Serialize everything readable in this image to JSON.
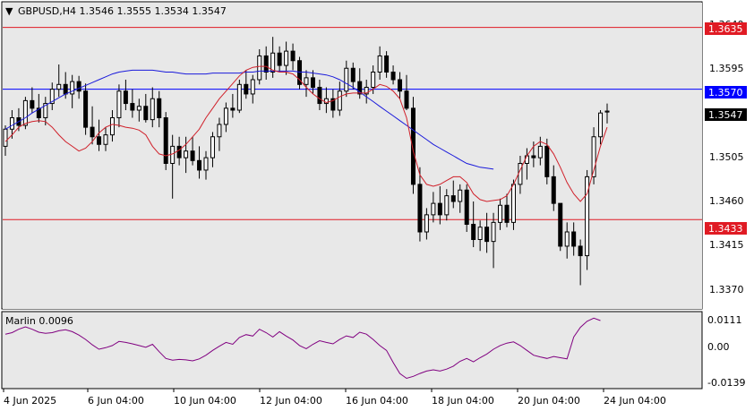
{
  "header": {
    "dropdown_glyph": "▼",
    "symbol_line": "GBPUSD,H4  1.3546 1.3555 1.3534 1.3547"
  },
  "price_axis": {
    "ticks": [
      "1.3640",
      "1.3595",
      "1.3550",
      "1.3505",
      "1.3460",
      "1.3415",
      "1.3370"
    ],
    "tags": [
      {
        "label": "1.3635",
        "value": 1.3635,
        "color": "#e01b24",
        "kind": "horizontal-line"
      },
      {
        "label": "1.3570",
        "value": 1.357,
        "color": "#0000ff",
        "kind": "horizontal-line"
      },
      {
        "label": "1.3547",
        "value": 1.3547,
        "color": "#000000",
        "kind": "current-price"
      },
      {
        "label": "1.3433",
        "value": 1.3433,
        "color": "#e01b24",
        "kind": "horizontal-line"
      }
    ]
  },
  "indicator_panel": {
    "label": "Marlin 0.0096",
    "ticks": [
      "0.0111",
      "0.00",
      "-0.0139"
    ],
    "color": "#800080"
  },
  "time_axis": {
    "labels": [
      "4 Jun 2025",
      "6 Jun 04:00",
      "10 Jun 04:00",
      "12 Jun 04:00",
      "16 Jun 04:00",
      "18 Jun 04:00",
      "20 Jun 04:00",
      "24 Jun 04:00"
    ]
  },
  "colors": {
    "background": "#e8e8e8",
    "bull_fill": "#ffffff",
    "bear_fill": "#000000",
    "slow_ma": "#1a1adb",
    "fast_ma": "#d0202a",
    "oscillator": "#800080"
  },
  "chart_data": {
    "type": "candlestick",
    "symbol": "GBPUSD",
    "timeframe": "H4",
    "last_bar": {
      "open": 1.3546,
      "high": 1.3555,
      "low": 1.3534,
      "close": 1.3547
    },
    "price_range": [
      1.334,
      1.366
    ],
    "ohlc": [
      [
        1.351,
        1.3532,
        1.35,
        1.3528
      ],
      [
        1.3528,
        1.3548,
        1.3518,
        1.354
      ],
      [
        1.354,
        1.355,
        1.3526,
        1.3532
      ],
      [
        1.3532,
        1.3562,
        1.3528,
        1.3558
      ],
      [
        1.3558,
        1.3572,
        1.3545,
        1.355
      ],
      [
        1.355,
        1.3565,
        1.3535,
        1.354
      ],
      [
        1.354,
        1.3562,
        1.3532,
        1.3555
      ],
      [
        1.3555,
        1.3577,
        1.3548,
        1.357
      ],
      [
        1.357,
        1.3596,
        1.3562,
        1.3575
      ],
      [
        1.3575,
        1.3588,
        1.356,
        1.3565
      ],
      [
        1.3565,
        1.3585,
        1.355,
        1.3578
      ],
      [
        1.3578,
        1.3584,
        1.356,
        1.3568
      ],
      [
        1.3568,
        1.3576,
        1.3522,
        1.353
      ],
      [
        1.353,
        1.3552,
        1.3512,
        1.352
      ],
      [
        1.352,
        1.3538,
        1.3505,
        1.3512
      ],
      [
        1.3512,
        1.353,
        1.3505,
        1.3522
      ],
      [
        1.3522,
        1.3548,
        1.3515,
        1.354
      ],
      [
        1.354,
        1.3575,
        1.353,
        1.3568
      ],
      [
        1.3568,
        1.358,
        1.3548,
        1.3555
      ],
      [
        1.3555,
        1.357,
        1.354,
        1.3548
      ],
      [
        1.3548,
        1.356,
        1.3536,
        1.3552
      ],
      [
        1.3552,
        1.3565,
        1.3535,
        1.3538
      ],
      [
        1.3538,
        1.3572,
        1.353,
        1.356
      ],
      [
        1.356,
        1.3568,
        1.353,
        1.354
      ],
      [
        1.354,
        1.3546,
        1.3485,
        1.3492
      ],
      [
        1.3492,
        1.3522,
        1.3455,
        1.351
      ],
      [
        1.351,
        1.352,
        1.349,
        1.3498
      ],
      [
        1.3498,
        1.352,
        1.3482,
        1.3505
      ],
      [
        1.3505,
        1.352,
        1.349,
        1.3495
      ],
      [
        1.3495,
        1.351,
        1.3476,
        1.3485
      ],
      [
        1.3485,
        1.3505,
        1.3475,
        1.3498
      ],
      [
        1.3498,
        1.3525,
        1.3488,
        1.352
      ],
      [
        1.352,
        1.354,
        1.3505,
        1.3533
      ],
      [
        1.3533,
        1.3556,
        1.3525,
        1.355
      ],
      [
        1.355,
        1.3565,
        1.354,
        1.3548
      ],
      [
        1.3548,
        1.358,
        1.3545,
        1.3575
      ],
      [
        1.3575,
        1.359,
        1.356,
        1.3565
      ],
      [
        1.3565,
        1.3585,
        1.3555,
        1.358
      ],
      [
        1.358,
        1.3612,
        1.3575,
        1.3605
      ],
      [
        1.3605,
        1.3615,
        1.358,
        1.3588
      ],
      [
        1.3588,
        1.3625,
        1.3582,
        1.3608
      ],
      [
        1.3608,
        1.3615,
        1.3588,
        1.3595
      ],
      [
        1.3595,
        1.362,
        1.3585,
        1.361
      ],
      [
        1.361,
        1.3618,
        1.359,
        1.36
      ],
      [
        1.36,
        1.3604,
        1.357,
        1.3575
      ],
      [
        1.3575,
        1.359,
        1.3562,
        1.3582
      ],
      [
        1.3582,
        1.359,
        1.3565,
        1.3572
      ],
      [
        1.3572,
        1.358,
        1.3548,
        1.3555
      ],
      [
        1.3555,
        1.3572,
        1.3545,
        1.356
      ],
      [
        1.356,
        1.357,
        1.354,
        1.3548
      ],
      [
        1.3548,
        1.3578,
        1.3542,
        1.3568
      ],
      [
        1.3568,
        1.36,
        1.3562,
        1.3592
      ],
      [
        1.3592,
        1.3598,
        1.357,
        1.3578
      ],
      [
        1.3578,
        1.3592,
        1.356,
        1.3565
      ],
      [
        1.3565,
        1.358,
        1.3555,
        1.3572
      ],
      [
        1.3572,
        1.3595,
        1.3565,
        1.3588
      ],
      [
        1.3588,
        1.3615,
        1.358,
        1.3605
      ],
      [
        1.3605,
        1.361,
        1.3582,
        1.3588
      ],
      [
        1.3588,
        1.3595,
        1.3575,
        1.358
      ],
      [
        1.358,
        1.3588,
        1.356,
        1.3568
      ],
      [
        1.3568,
        1.3585,
        1.3548,
        1.355
      ],
      [
        1.355,
        1.3562,
        1.346,
        1.347
      ],
      [
        1.347,
        1.3488,
        1.341,
        1.342
      ],
      [
        1.342,
        1.3445,
        1.3412,
        1.3438
      ],
      [
        1.3438,
        1.3462,
        1.343,
        1.345
      ],
      [
        1.345,
        1.3468,
        1.3428,
        1.3438
      ],
      [
        1.3438,
        1.3465,
        1.3432,
        1.3458
      ],
      [
        1.3458,
        1.3474,
        1.3445,
        1.3452
      ],
      [
        1.3452,
        1.347,
        1.344,
        1.3464
      ],
      [
        1.3464,
        1.347,
        1.342,
        1.3428
      ],
      [
        1.3428,
        1.3452,
        1.3404,
        1.3412
      ],
      [
        1.3412,
        1.3432,
        1.34,
        1.3425
      ],
      [
        1.3425,
        1.344,
        1.3398,
        1.341
      ],
      [
        1.341,
        1.344,
        1.3382,
        1.343
      ],
      [
        1.343,
        1.3455,
        1.3422,
        1.3448
      ],
      [
        1.3448,
        1.346,
        1.3425,
        1.343
      ],
      [
        1.343,
        1.3475,
        1.3422,
        1.347
      ],
      [
        1.347,
        1.35,
        1.346,
        1.3492
      ],
      [
        1.3492,
        1.3508,
        1.3475,
        1.35
      ],
      [
        1.35,
        1.3515,
        1.3488,
        1.3498
      ],
      [
        1.3498,
        1.352,
        1.349,
        1.351
      ],
      [
        1.351,
        1.3518,
        1.347,
        1.3478
      ],
      [
        1.3478,
        1.349,
        1.3442,
        1.345
      ],
      [
        1.345,
        1.3445,
        1.34,
        1.3405
      ],
      [
        1.3405,
        1.343,
        1.3392,
        1.342
      ],
      [
        1.342,
        1.343,
        1.3395,
        1.3405
      ],
      [
        1.3405,
        1.3412,
        1.3364,
        1.3395
      ],
      [
        1.3395,
        1.3485,
        1.338,
        1.3478
      ],
      [
        1.3478,
        1.353,
        1.347,
        1.352
      ],
      [
        1.352,
        1.3548,
        1.3512,
        1.3545
      ],
      [
        1.3546,
        1.3555,
        1.3534,
        1.3547
      ]
    ],
    "fast_ma": [
      1.3515,
      1.3522,
      1.353,
      1.3534,
      1.3536,
      1.3537,
      1.3536,
      1.353,
      1.3522,
      1.3515,
      1.351,
      1.3505,
      1.3508,
      1.3515,
      1.3524,
      1.353,
      1.3533,
      1.3532,
      1.353,
      1.3529,
      1.3527,
      1.3522,
      1.351,
      1.3502,
      1.35,
      1.3502,
      1.3506,
      1.3512,
      1.352,
      1.3528,
      1.354,
      1.355,
      1.356,
      1.3568,
      1.3576,
      1.3584,
      1.359,
      1.3593,
      1.3594,
      1.3594,
      1.359,
      1.3588,
      1.3588,
      1.3586,
      1.358,
      1.3572,
      1.3565,
      1.356,
      1.3556,
      1.3558,
      1.3562,
      1.3565,
      1.3566,
      1.3566,
      1.3566,
      1.357,
      1.3575,
      1.3573,
      1.3568,
      1.356,
      1.354,
      1.3505,
      1.348,
      1.347,
      1.3468,
      1.347,
      1.3474,
      1.3478,
      1.3478,
      1.3472,
      1.346,
      1.3454,
      1.3452,
      1.3453,
      1.3454,
      1.3458,
      1.347,
      1.3485,
      1.35,
      1.351,
      1.3515,
      1.3512,
      1.3502,
      1.3488,
      1.3472,
      1.346,
      1.3452,
      1.346,
      1.3485,
      1.351,
      1.353
    ],
    "slow_ma": [
      1.3528,
      1.3532,
      1.3536,
      1.354,
      1.3545,
      1.3549,
      1.3553,
      1.3557,
      1.3561,
      1.3565,
      1.3568,
      1.3571,
      1.3574,
      1.3577,
      1.358,
      1.3583,
      1.3586,
      1.3588,
      1.3589,
      1.359,
      1.359,
      1.359,
      1.359,
      1.3589,
      1.3588,
      1.3588,
      1.3587,
      1.3586,
      1.3586,
      1.3586,
      1.3586,
      1.3587,
      1.3587,
      1.3587,
      1.3587,
      1.3587,
      1.3588,
      1.3588,
      1.3589,
      1.3589,
      1.3589,
      1.3589,
      1.3589,
      1.3589,
      1.3588,
      1.3588,
      1.3587,
      1.3586,
      1.3585,
      1.3583,
      1.358,
      1.3576,
      1.3572,
      1.3567,
      1.3562,
      1.3557,
      1.3552,
      1.3547,
      1.3542,
      1.3537,
      1.3532,
      1.3527,
      1.3522,
      1.3517,
      1.3512,
      1.3508,
      1.3504,
      1.35,
      1.3496,
      1.3492,
      1.349,
      1.3488,
      1.3487,
      1.3486
    ],
    "marlin": [
      0.0052,
      0.0058,
      0.0072,
      0.0082,
      0.0072,
      0.006,
      0.0055,
      0.0058,
      0.0066,
      0.007,
      0.0062,
      0.0048,
      0.003,
      0.0008,
      -0.001,
      -0.0004,
      0.0005,
      0.0022,
      0.0018,
      0.0012,
      0.0005,
      -0.0002,
      0.001,
      -0.002,
      -0.0048,
      -0.0055,
      -0.0052,
      -0.0054,
      -0.0058,
      -0.005,
      -0.0035,
      -0.0015,
      0.0002,
      0.0018,
      0.001,
      0.0038,
      0.005,
      0.0044,
      0.0072,
      0.0058,
      0.004,
      0.0062,
      0.0044,
      0.0028,
      0.0005,
      -0.0008,
      0.001,
      0.0025,
      0.0018,
      0.0012,
      0.003,
      0.0045,
      0.0038,
      0.006,
      0.0052,
      0.003,
      0.0005,
      -0.0015,
      -0.0065,
      -0.011,
      -0.013,
      -0.0122,
      -0.011,
      -0.01,
      -0.0095,
      -0.01,
      -0.0092,
      -0.008,
      -0.006,
      -0.0048,
      -0.0062,
      -0.0045,
      -0.003,
      -0.001,
      0.0005,
      0.0015,
      0.002,
      0.0005,
      -0.0015,
      -0.0035,
      -0.0042,
      -0.0048,
      -0.004,
      -0.0045,
      -0.005,
      0.004,
      0.008,
      0.0105,
      0.0118,
      0.0108
    ],
    "marlin_range": [
      -0.0165,
      0.013
    ]
  }
}
